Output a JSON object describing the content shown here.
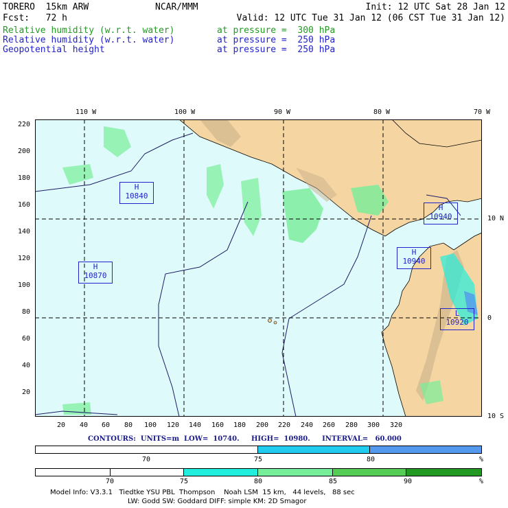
{
  "header": {
    "model": "TORERO  15km ARW",
    "org": "NCAR/MMM",
    "init": "Init: 12 UTC Sat 28 Jan 12",
    "fcst": "Fcst:   72 h",
    "valid": "Valid: 12 UTC Tue 31 Jan 12 (06 CST Tue 31 Jan 12)",
    "fields": [
      {
        "name": "Relative humidity (w.r.t. water)",
        "level": "at pressure =  300 hPa",
        "color": "#229922"
      },
      {
        "name": "Relative humidity (w.r.t. water)",
        "level": "at pressure =  250 hPa",
        "color": "#2222cc"
      },
      {
        "name": "Geopotential height",
        "level": "at pressure =  250 hPa",
        "color": "#2222cc"
      }
    ]
  },
  "map": {
    "ocean_color": "#dffafa",
    "land_color": "#f5d6a3",
    "longitude_labels": [
      "110 W",
      "100 W",
      "90 W",
      "80 W",
      "70 W"
    ],
    "latitude_labels": [
      "10 N",
      "0",
      "10 S"
    ],
    "grid_y_ticks": [
      "220",
      "200",
      "180",
      "160",
      "140",
      "120",
      "100",
      "80",
      "60",
      "40",
      "20"
    ],
    "grid_x_ticks": [
      "20",
      "40",
      "60",
      "80",
      "100",
      "120",
      "140",
      "160",
      "180",
      "200",
      "220",
      "240",
      "260",
      "280",
      "300",
      "320"
    ],
    "centers": [
      {
        "type": "H",
        "value": "10840"
      },
      {
        "type": "H",
        "value": "10870"
      },
      {
        "type": "H",
        "value": "10940"
      },
      {
        "type": "H",
        "value": "10940"
      },
      {
        "type": "L",
        "value": "10920"
      }
    ]
  },
  "contour_info": {
    "label": "CONTOURS:  UNITS=m  LOW=  10740.     HIGH=  10980.     INTERVAL=   60.000"
  },
  "legend_250": {
    "colors": [
      "#ffffff",
      "#22ccee",
      "#5599ee"
    ],
    "ticks": [
      "70",
      "75",
      "80"
    ],
    "unit": "%"
  },
  "legend_300": {
    "colors": [
      "#ffffff",
      "#ffffff",
      "#22eedd",
      "#77ee99",
      "#55cc55",
      "#229922"
    ],
    "ticks": [
      "70",
      "75",
      "80",
      "85",
      "90"
    ],
    "unit": "%"
  },
  "footer": {
    "line1": "Model Info: V3.3.1   Tiedtke YSU PBL  Thompson    Noah LSM  15 km,   44 levels,   88 sec",
    "line2": "LW: Godd SW: Goddard DIFF: simple KM: 2D Smagor"
  }
}
